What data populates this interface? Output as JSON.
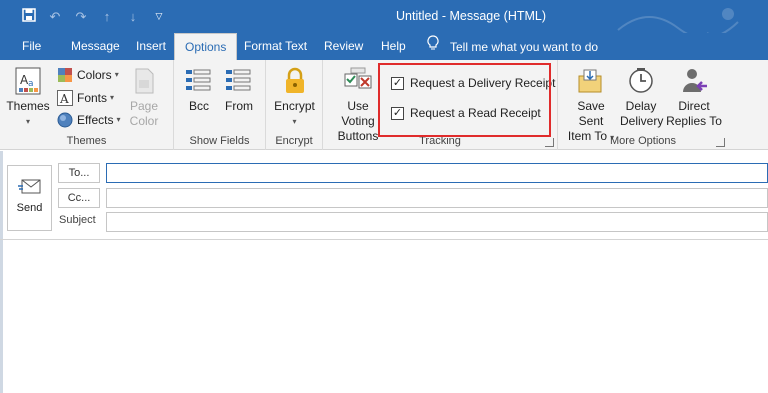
{
  "window": {
    "title": "Untitled  -  Message (HTML)",
    "qat": [
      "save-icon",
      "undo-icon",
      "redo-icon",
      "up-arrow-icon",
      "down-arrow-icon",
      "customize-qat-icon"
    ]
  },
  "tabs": [
    {
      "label": "File"
    },
    {
      "label": "Message"
    },
    {
      "label": "Insert"
    },
    {
      "label": "Options"
    },
    {
      "label": "Format Text"
    },
    {
      "label": "Review"
    },
    {
      "label": "Help"
    }
  ],
  "tell_me": "Tell me what you want to do",
  "ribbon": {
    "themes": {
      "group_label": "Themes",
      "themes_btn": "Themes",
      "colors": "Colors",
      "fonts": "Fonts",
      "effects": "Effects",
      "page_color_line1": "Page",
      "page_color_line2": "Color"
    },
    "show_fields": {
      "group_label": "Show Fields",
      "bcc": "Bcc",
      "from": "From"
    },
    "encrypt": {
      "group_label": "Encrypt",
      "encrypt_btn": "Encrypt"
    },
    "tracking": {
      "group_label": "Tracking",
      "voting_line1": "Use Voting",
      "voting_line2": "Buttons",
      "delivery_receipt": "Request a Delivery Receipt",
      "read_receipt": "Request a Read Receipt",
      "delivery_checked": true,
      "read_checked": true
    },
    "more_options": {
      "group_label": "More Options",
      "save_sent_line1": "Save Sent",
      "save_sent_line2": "Item To",
      "delay_line1": "Delay",
      "delay_line2": "Delivery",
      "direct_line1": "Direct",
      "direct_line2": "Replies To"
    }
  },
  "compose": {
    "send": "Send",
    "to": "To...",
    "cc": "Cc...",
    "subject": "Subject",
    "to_value": "",
    "cc_value": "",
    "subject_value": ""
  },
  "colors": {
    "accent": "#2b6cb4",
    "highlight": "#e02b2b"
  }
}
